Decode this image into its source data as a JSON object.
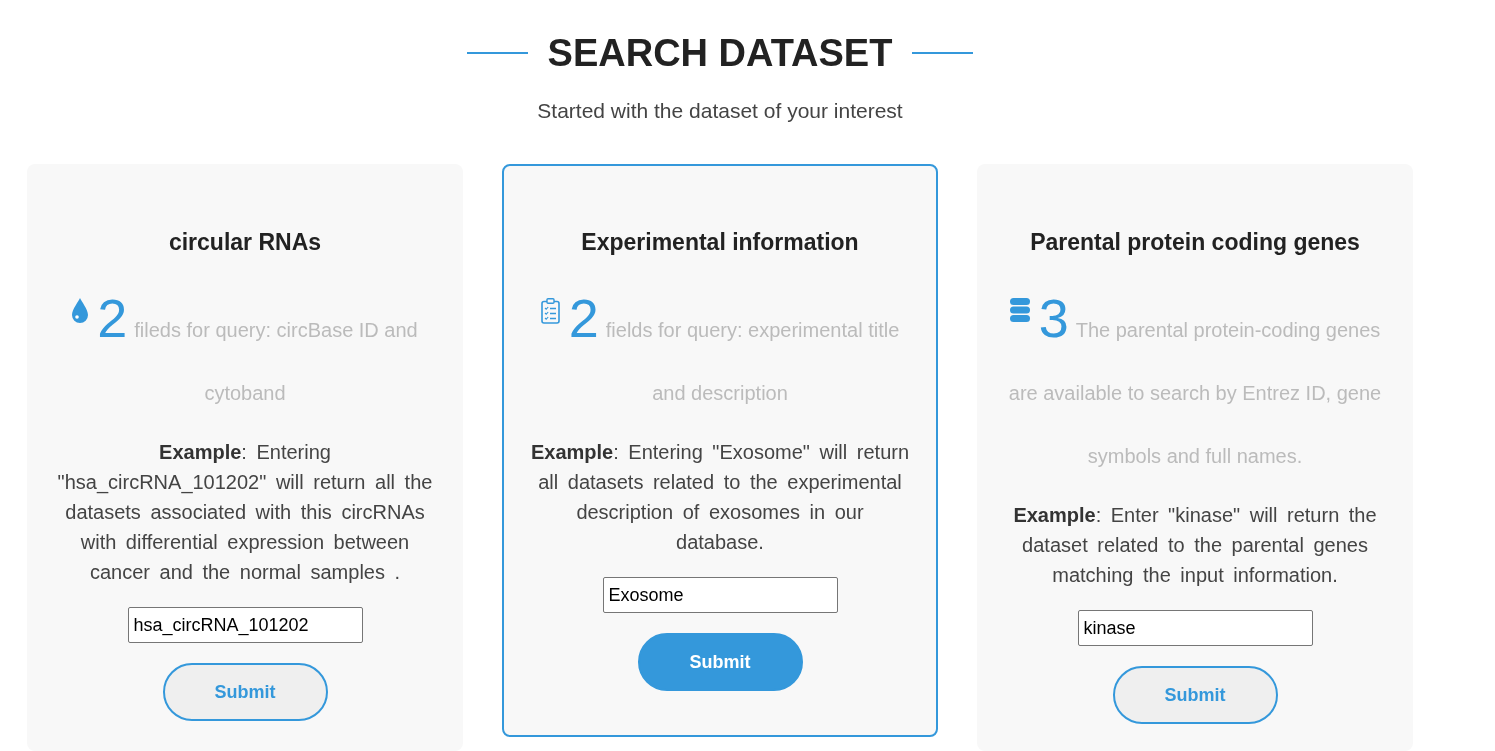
{
  "header": {
    "title": "SEARCH DATASET",
    "subtitle": "Started with the dataset of your interest"
  },
  "cards": [
    {
      "title": "circular RNAs",
      "count": "2",
      "description": "fileds for query: circBase ID and cytoband",
      "example": "**Example**: Entering \"hsa_circRNA_101202\" will return all the datasets associated with this circRNAs with differential expression between cancer and the normal samples .",
      "input": {
        "value": "hsa_circRNA_101202"
      },
      "button": {
        "label": "Submit"
      },
      "selected": false
    },
    {
      "title": "Experimental information",
      "count": "2",
      "description": "fields for query: experimental title and description",
      "example": "**Example**: Entering \"Exosome\" will return all datasets related to the experimental description of exosomes in our database.",
      "input": {
        "value": "Exosome"
      },
      "button": {
        "label": "Submit"
      },
      "selected": true
    },
    {
      "title": "Parental protein coding genes",
      "count": "3",
      "description": "The parental protein-coding genes are available to search by Entrez ID, gene symbols and full names.",
      "example": "**Example**: Enter \"kinase\" will return the dataset related to the parental genes matching the input information.",
      "input": {
        "value": "kinase"
      },
      "button": {
        "label": "Submit"
      },
      "selected": false
    }
  ]
}
